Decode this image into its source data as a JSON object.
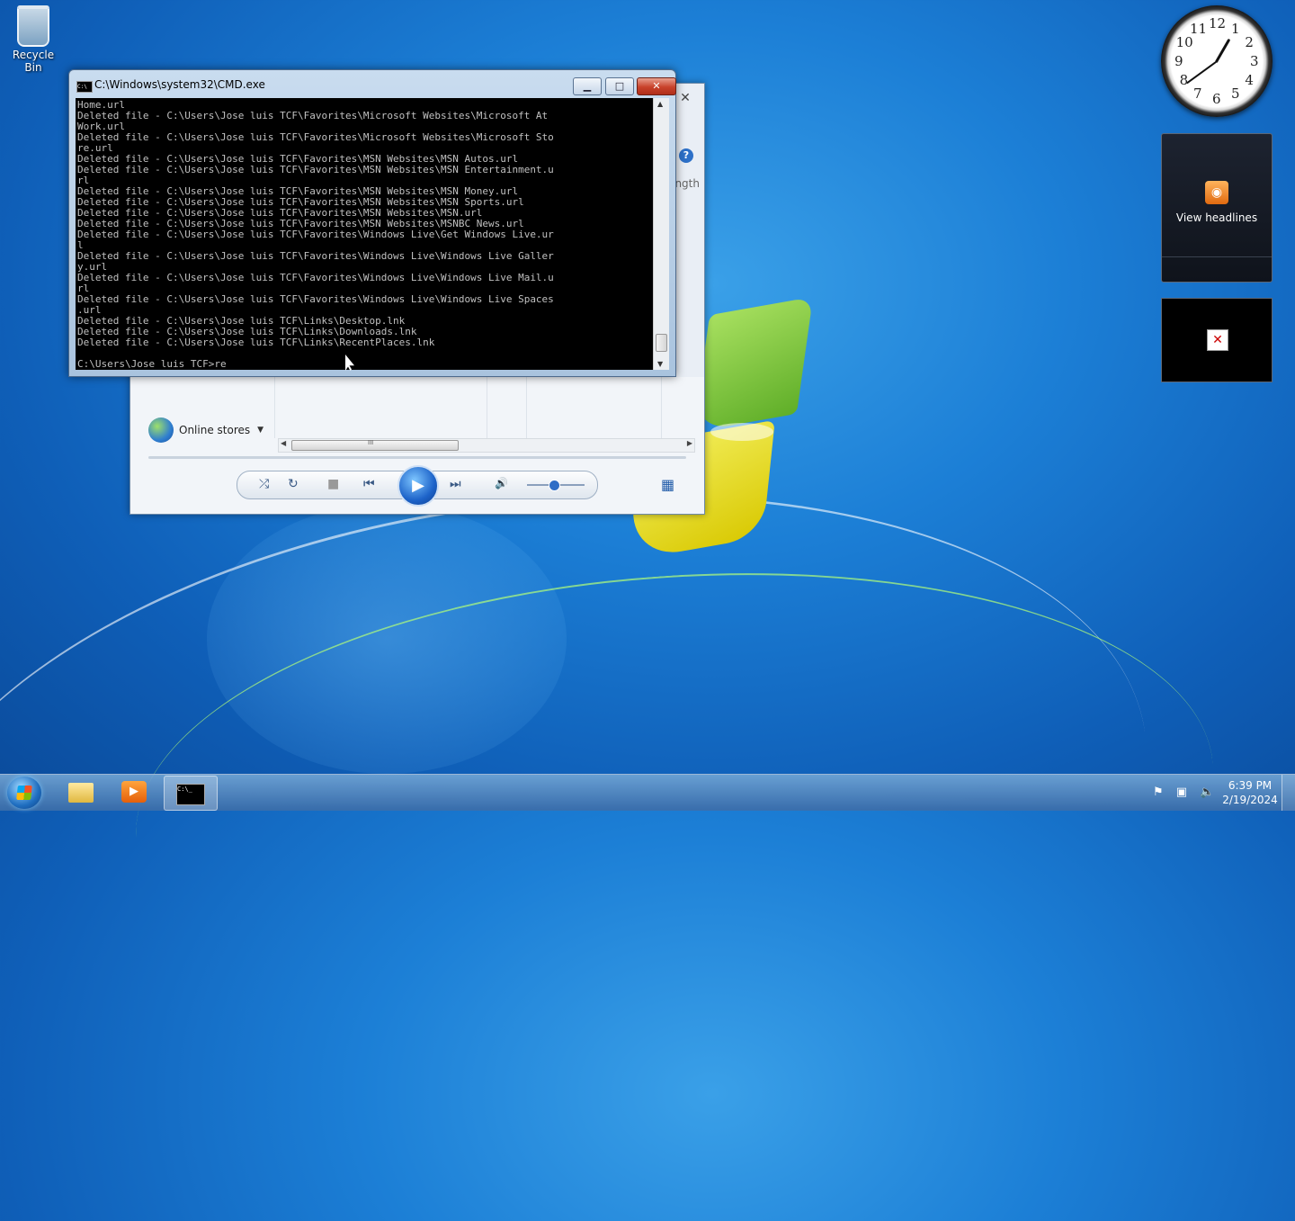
{
  "desktop": {
    "icons": [
      {
        "label": "Recycle Bin",
        "icon": "recycle-bin-icon"
      }
    ]
  },
  "cmd_window": {
    "title": "C:\\Windows\\system32\\CMD.exe",
    "minimize": "▁",
    "maximize": "□",
    "close": "✕",
    "lines": [
      "Home.url",
      "Deleted file - C:\\Users\\Jose luis TCF\\Favorites\\Microsoft Websites\\Microsoft At",
      "Work.url",
      "Deleted file - C:\\Users\\Jose luis TCF\\Favorites\\Microsoft Websites\\Microsoft Sto",
      "re.url",
      "Deleted file - C:\\Users\\Jose luis TCF\\Favorites\\MSN Websites\\MSN Autos.url",
      "Deleted file - C:\\Users\\Jose luis TCF\\Favorites\\MSN Websites\\MSN Entertainment.u",
      "rl",
      "Deleted file - C:\\Users\\Jose luis TCF\\Favorites\\MSN Websites\\MSN Money.url",
      "Deleted file - C:\\Users\\Jose luis TCF\\Favorites\\MSN Websites\\MSN Sports.url",
      "Deleted file - C:\\Users\\Jose luis TCF\\Favorites\\MSN Websites\\MSN.url",
      "Deleted file - C:\\Users\\Jose luis TCF\\Favorites\\MSN Websites\\MSNBC News.url",
      "Deleted file - C:\\Users\\Jose luis TCF\\Favorites\\Windows Live\\Get Windows Live.ur",
      "l",
      "Deleted file - C:\\Users\\Jose luis TCF\\Favorites\\Windows Live\\Windows Live Galler",
      "y.url",
      "Deleted file - C:\\Users\\Jose luis TCF\\Favorites\\Windows Live\\Windows Live Mail.u",
      "rl",
      "Deleted file - C:\\Users\\Jose luis TCF\\Favorites\\Windows Live\\Windows Live Spaces",
      ".url",
      "Deleted file - C:\\Users\\Jose luis TCF\\Links\\Desktop.lnk",
      "Deleted file - C:\\Users\\Jose luis TCF\\Links\\Downloads.lnk",
      "Deleted file - C:\\Users\\Jose luis TCF\\Links\\RecentPlaces.lnk",
      "",
      "C:\\Users\\Jose luis TCF>re"
    ]
  },
  "media_player": {
    "close": "✕",
    "help": "?",
    "length_label": "ngth",
    "online_stores": "Online stores",
    "scroll_grip": "III",
    "controls": {
      "shuffle": "⤮",
      "repeat": "↻",
      "stop": "■",
      "prev": "⏮",
      "play": "▶",
      "next": "⏭",
      "mute": "🔊",
      "switch": "▦"
    },
    "volume": 0.5
  },
  "gadgets": {
    "clock": {
      "numbers": [
        "12",
        "1",
        "2",
        "3",
        "4",
        "5",
        "6",
        "7",
        "8",
        "9",
        "10",
        "11"
      ]
    },
    "feed": {
      "label": "View headlines",
      "icon": "rss-icon"
    }
  },
  "taskbar": {
    "items": [
      {
        "name": "windows-explorer",
        "icon": "folder-icon"
      },
      {
        "name": "windows-media-player",
        "icon": "media-player-icon"
      },
      {
        "name": "cmd",
        "icon": "cmd-icon",
        "active": true
      }
    ],
    "time": "6:39 PM",
    "date": "2/19/2024",
    "tray": [
      "flag-icon",
      "network-icon",
      "volume-muted-icon"
    ]
  }
}
